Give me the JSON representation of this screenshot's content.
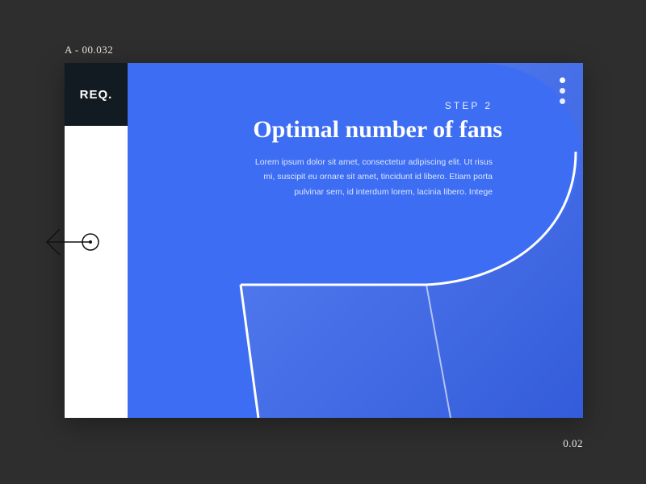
{
  "frame": {
    "top_label": "A - 00.032",
    "bottom_label": "0.02"
  },
  "sidebar": {
    "logo": "REQ."
  },
  "main": {
    "step_label": "STEP 2",
    "headline": "Optimal number of fans",
    "body": "Lorem ipsum dolor sit amet, consectetur adipiscing elit. Ut risus mi, suscipit eu ornare sit amet, tincidunt id libero.  Etiam porta pulvinar sem, id interdum lorem, lacinia libero. Intege"
  },
  "icons": {
    "menu_dots": "menu-dots",
    "back_arrow": "back-arrow"
  },
  "colors": {
    "bg": "#2e2e2e",
    "panel_blue": "#3d6df2",
    "logo_bg": "#121a22"
  }
}
